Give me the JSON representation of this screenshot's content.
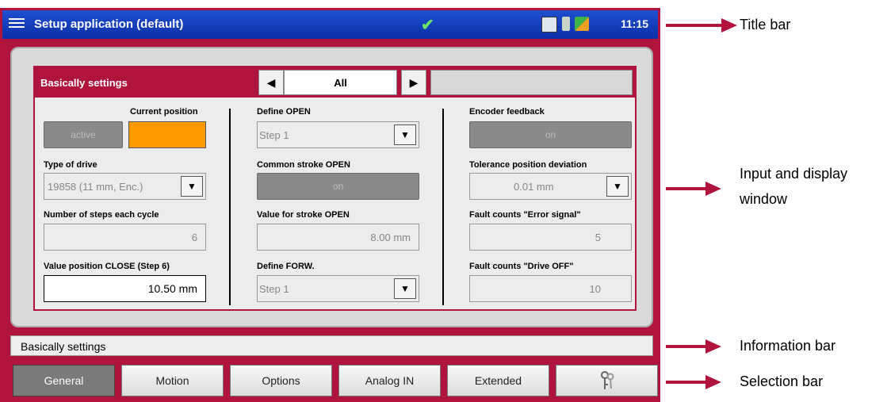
{
  "title_bar": {
    "title": "Setup application (default)",
    "status_icons": [
      "checkmark-icon",
      "monitor-icon",
      "bottle-icon",
      "puzzle-icon"
    ],
    "clock": "11:15"
  },
  "panel": {
    "title": "Basically settings",
    "nav_value": "All",
    "columns": {
      "left": {
        "active_label": "active",
        "current_position_label": "Current position",
        "type_of_drive_label": "Type of drive",
        "type_of_drive_value": "19858 (11 mm, Enc.)",
        "steps_label": "Number of steps each cycle",
        "steps_value": "6",
        "close_label": "Value position CLOSE (Step 6)",
        "close_value": "10.50  mm"
      },
      "middle": {
        "define_open_label": "Define OPEN",
        "define_open_value": "Step 1",
        "common_stroke_label": "Common stroke OPEN",
        "common_stroke_value": "on",
        "stroke_value_label": "Value for stroke OPEN",
        "stroke_value": "8.00  mm",
        "define_forw_label": "Define FORW.",
        "define_forw_value": "Step 1"
      },
      "right": {
        "encoder_label": "Encoder feedback",
        "encoder_value": "on",
        "tolerance_label": "Tolerance position deviation",
        "tolerance_value": "0.01 mm",
        "fault_error_label": "Fault counts \"Error signal\"",
        "fault_error_value": "5",
        "fault_drive_label": "Fault counts \"Drive OFF\"",
        "fault_drive_value": "10"
      }
    }
  },
  "info_bar": {
    "text": "Basically settings"
  },
  "selection_bar": {
    "tabs": [
      "General",
      "Motion",
      "Options",
      "Analog IN",
      "Extended"
    ],
    "selected": "General",
    "last_icon": "keys-icon"
  },
  "callouts": {
    "title_bar": "Title bar",
    "input_display_line1": "Input and display",
    "input_display_line2": "window",
    "information_bar": "Information bar",
    "selection_bar": "Selection bar"
  },
  "colors": {
    "frame": "#b0133c",
    "title_bar": "#1f4fd0",
    "current_position": "#ff9a00"
  }
}
